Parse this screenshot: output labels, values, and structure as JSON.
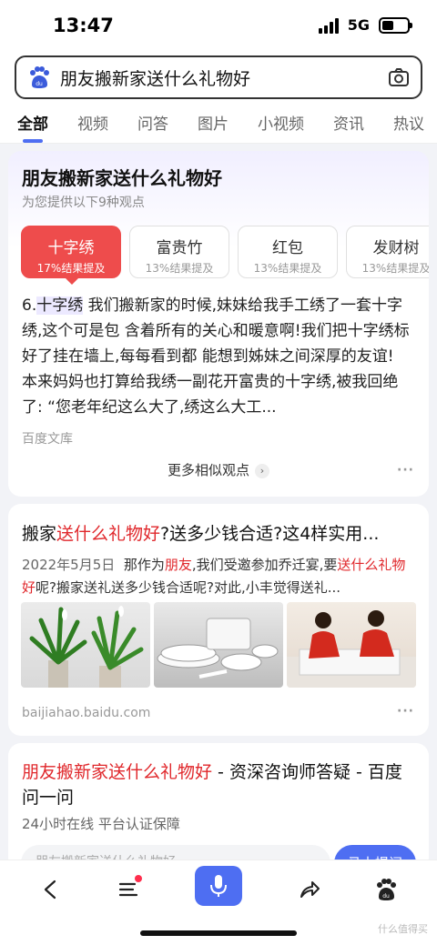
{
  "status": {
    "time": "13:47",
    "network": "5G"
  },
  "search": {
    "query": "朋友搬新家送什么礼物好"
  },
  "tabs": [
    "全部",
    "视频",
    "问答",
    "图片",
    "小视频",
    "资讯",
    "热议"
  ],
  "card1": {
    "title": "朋友搬新家送什么礼物好",
    "subtitle": "为您提供以下9种观点",
    "chips": [
      {
        "name": "十字绣",
        "pct": "17%结果提及"
      },
      {
        "name": "富贵竹",
        "pct": "13%结果提及"
      },
      {
        "name": "红包",
        "pct": "13%结果提及"
      },
      {
        "name": "发财树",
        "pct": "13%结果提及"
      }
    ],
    "body_prefix": "6.",
    "body_keyword": "十字绣",
    "body_rest": " 我们搬新家的时候,妹妹给我手工绣了一套十字绣,这个可是包 含着所有的关心和暖意啊!我们把十字绣标好了挂在墙上,每每看到都 能想到姊妹之间深厚的友谊! 本来妈妈也打算给我绣一副花开富贵的十字绣,被我回绝了: “您老年纪这么大了,绣这么大工...",
    "source": "百度文库",
    "more": "更多相似观点",
    "more_arrow": "›",
    "dots": "···"
  },
  "card2": {
    "title_a": "搬家",
    "title_b": "送什么礼物好",
    "title_c": "?送多少钱合适?这4样实用...",
    "date": "2022年5月5日",
    "desc_a": "那作为",
    "desc_b": "朋友",
    "desc_c": ",我们受邀参加乔迁宴,要",
    "desc_d": "送什么礼物好",
    "desc_e": "呢?搬家送礼送多少钱合适呢?对此,小丰觉得送礼...",
    "source": "baijiahao.baidu.com",
    "dots": "···"
  },
  "card3": {
    "title_red": "朋友搬新家送什么礼物好",
    "title_rest": " - 资深咨询师答疑 - 百度问一问",
    "sub": "24小时在线 平台认证保障",
    "input_placeholder": "朋友搬新家送什么礼物好",
    "button": "马上提问"
  },
  "watermark": "什么值得买",
  "colors": {
    "accent": "#4e6ef2",
    "highlight_red": "#e0272b",
    "chip_active": "#ee4c4c"
  }
}
